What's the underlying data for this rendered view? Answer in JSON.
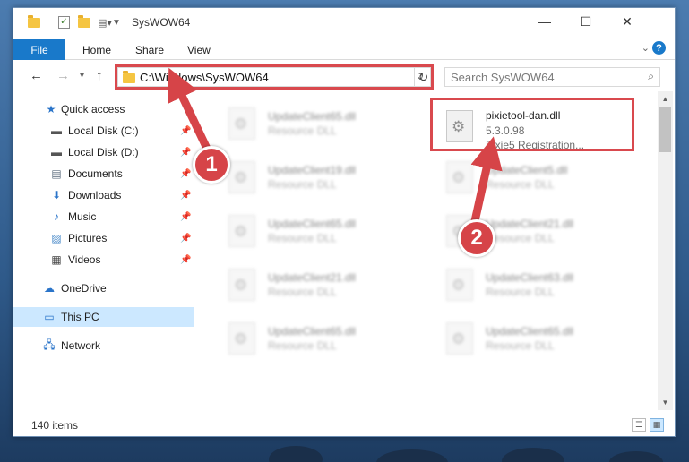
{
  "window": {
    "title": "SysWOW64",
    "minimize": "—",
    "maximize": "☐",
    "close": "✕"
  },
  "ribbon": {
    "file_tab": "File",
    "tabs": [
      "Home",
      "Share",
      "View"
    ]
  },
  "address_bar": {
    "path": "C:\\Windows\\SysWOW64",
    "search_placeholder": "Search SysWOW64"
  },
  "nav": {
    "items": [
      {
        "label": "Quick access",
        "icon": "star-icon",
        "pinned": false
      },
      {
        "label": "Local Disk (C:)",
        "icon": "drive-icon",
        "pinned": true
      },
      {
        "label": "Local Disk (D:)",
        "icon": "drive-icon",
        "pinned": true
      },
      {
        "label": "Documents",
        "icon": "documents-icon",
        "pinned": true
      },
      {
        "label": "Downloads",
        "icon": "download-icon",
        "pinned": true
      },
      {
        "label": "Music",
        "icon": "music-icon",
        "pinned": true
      },
      {
        "label": "Pictures",
        "icon": "pictures-icon",
        "pinned": true
      },
      {
        "label": "Videos",
        "icon": "videos-icon",
        "pinned": true
      },
      {
        "label": "OneDrive",
        "icon": "cloud-icon",
        "pinned": false
      },
      {
        "label": "This PC",
        "icon": "computer-icon",
        "pinned": false,
        "selected": true
      },
      {
        "label": "Network",
        "icon": "network-icon",
        "pinned": false
      }
    ]
  },
  "files": {
    "highlighted": {
      "name": "pixietool-dan.dll",
      "version": "5.3.0.98",
      "description": "Pixie5 Registration..."
    },
    "blurred": [
      {
        "name": "UpdateClient65.dll",
        "type": "Resource DLL"
      },
      {
        "name": "UpdateClient19.dll",
        "type": "Resource DLL"
      },
      {
        "name": "UpdateClient5.dll",
        "type": "Resource DLL"
      },
      {
        "name": "UpdateClient65.dll",
        "type": "Resource DLL"
      },
      {
        "name": "UpdateClient21.dll",
        "type": "Resource DLL"
      },
      {
        "name": "UpdateClient21.dll",
        "type": "Resource DLL"
      },
      {
        "name": "UpdateClient63.dll",
        "type": "Resource DLL"
      },
      {
        "name": "UpdateClient65.dll",
        "type": "Resource DLL"
      },
      {
        "name": "UpdateClient65.dll",
        "type": "Resource DLL"
      }
    ]
  },
  "status": {
    "item_count": "140 items"
  },
  "callouts": [
    "1",
    "2"
  ],
  "colors": {
    "accent": "#1979ca",
    "highlight_red": "#d9494e",
    "selected_bg": "#cce8ff"
  }
}
